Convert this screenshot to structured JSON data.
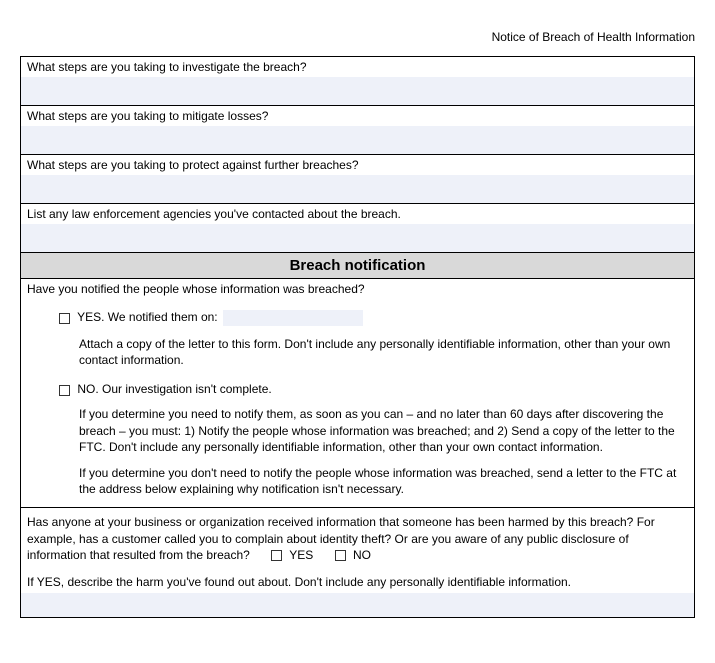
{
  "header": {
    "title": "Notice of Breach of Health Information"
  },
  "questions": {
    "investigate": "What steps are you taking to investigate the breach?",
    "mitigate": "What steps are you taking to mitigate losses?",
    "protect": "What steps are you taking to protect against further breaches?",
    "agencies": "List any law enforcement agencies you've contacted about the breach."
  },
  "section": {
    "breach_notification": "Breach notification"
  },
  "notify": {
    "question": "Have you notified the people whose information was breached?",
    "yes_label": "YES.  We notified them on:",
    "yes_note": "Attach a copy of the letter to this form.  Don't include any personally identifiable information, other than your own contact information.",
    "no_label": "NO.  Our investigation isn't complete.",
    "no_note1": "If you determine you need to notify them, as soon as you can – and no later than 60 days after discovering the breach – you must: 1) Notify the people whose information was breached; and 2) Send a copy of the letter to the FTC. Don't include any personally identifiable information, other than your own contact information.",
    "no_note2": "If you determine you don't need to notify the people whose information was breached, send a letter to the FTC at the address below explaining why notification isn't necessary."
  },
  "harm": {
    "question": "Has anyone at your business or organization received information that someone has been harmed by this breach?  For example, has a customer called you to complain about identity theft?  Or are you aware of any public disclosure of information that resulted from the breach?",
    "yes": "YES",
    "no": "NO",
    "describe": "If YES, describe the harm you've found out about.  Don't include any personally identifiable information."
  }
}
